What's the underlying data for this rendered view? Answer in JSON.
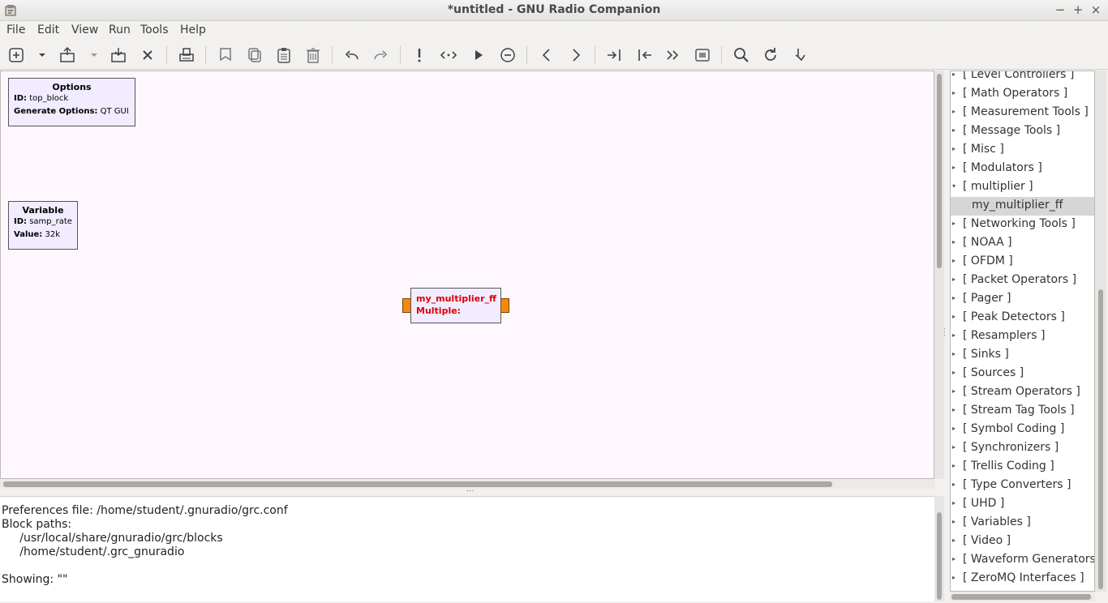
{
  "window": {
    "title": "*untitled - GNU Radio Companion",
    "controls": {
      "minimize": "−",
      "maximize": "+",
      "close": "×"
    }
  },
  "menu": [
    "File",
    "Edit",
    "View",
    "Run",
    "Tools",
    "Help"
  ],
  "toolbar": {
    "icons": [
      "new-icon",
      "new-dropdown-icon",
      "open-icon",
      "open-dropdown-icon",
      "save-icon",
      "close-icon",
      "print-icon",
      "cut-icon",
      "copy-icon",
      "paste-icon",
      "delete-icon",
      "undo-icon",
      "redo-icon",
      "generate-icon",
      "execute-icon",
      "kill-icon",
      "disable-icon",
      "rotate-ccw-icon",
      "rotate-cw-icon",
      "enable-icon",
      "bypass-icon",
      "bypass-all-icon",
      "screenshot-icon",
      "find-icon",
      "reload-icon",
      "hide-icon"
    ]
  },
  "canvas": {
    "options_block": {
      "title": "Options",
      "id_label": "ID:",
      "id_value": "top_block",
      "gen_label": "Generate Options:",
      "gen_value": "QT GUI"
    },
    "variable_block": {
      "title": "Variable",
      "id_label": "ID:",
      "id_value": "samp_rate",
      "value_label": "Value:",
      "value_value": "32k"
    },
    "custom_block": {
      "title": "my_multiplier_ff",
      "param_label": "Multiple:"
    },
    "bg_color": "#fef8fe",
    "block_color": "#f1ecff",
    "port_color": "#f28a10",
    "error_color": "#e00000"
  },
  "console": {
    "lines": [
      "Preferences file: /home/student/.gnuradio/grc.conf",
      "Block paths:",
      "     /usr/local/share/gnuradio/grc/blocks",
      "     /home/student/.grc_gnuradio",
      "",
      "Showing: \"\""
    ]
  },
  "tree": {
    "items": [
      {
        "label": "[ Level Controllers ]",
        "expanded": false
      },
      {
        "label": "[ Math Operators ]",
        "expanded": false
      },
      {
        "label": "[ Measurement Tools ]",
        "expanded": false
      },
      {
        "label": "[ Message Tools ]",
        "expanded": false
      },
      {
        "label": "[ Misc ]",
        "expanded": false
      },
      {
        "label": "[ Modulators ]",
        "expanded": false
      },
      {
        "label": "[ multiplier ]",
        "expanded": true
      },
      {
        "label": "my_multiplier_ff",
        "child": true,
        "selected": true
      },
      {
        "label": "[ Networking Tools ]",
        "expanded": false
      },
      {
        "label": "[ NOAA ]",
        "expanded": false
      },
      {
        "label": "[ OFDM ]",
        "expanded": false
      },
      {
        "label": "[ Packet Operators ]",
        "expanded": false
      },
      {
        "label": "[ Pager ]",
        "expanded": false
      },
      {
        "label": "[ Peak Detectors ]",
        "expanded": false
      },
      {
        "label": "[ Resamplers ]",
        "expanded": false
      },
      {
        "label": "[ Sinks ]",
        "expanded": false
      },
      {
        "label": "[ Sources ]",
        "expanded": false
      },
      {
        "label": "[ Stream Operators ]",
        "expanded": false
      },
      {
        "label": "[ Stream Tag Tools ]",
        "expanded": false
      },
      {
        "label": "[ Symbol Coding ]",
        "expanded": false
      },
      {
        "label": "[ Synchronizers ]",
        "expanded": false
      },
      {
        "label": "[ Trellis Coding ]",
        "expanded": false
      },
      {
        "label": "[ Type Converters ]",
        "expanded": false
      },
      {
        "label": "[ UHD ]",
        "expanded": false
      },
      {
        "label": "[ Variables ]",
        "expanded": false
      },
      {
        "label": "[ Video ]",
        "expanded": false
      },
      {
        "label": "[ Waveform Generators ]",
        "expanded": false
      },
      {
        "label": "[ ZeroMQ Interfaces ]",
        "expanded": false
      }
    ]
  }
}
